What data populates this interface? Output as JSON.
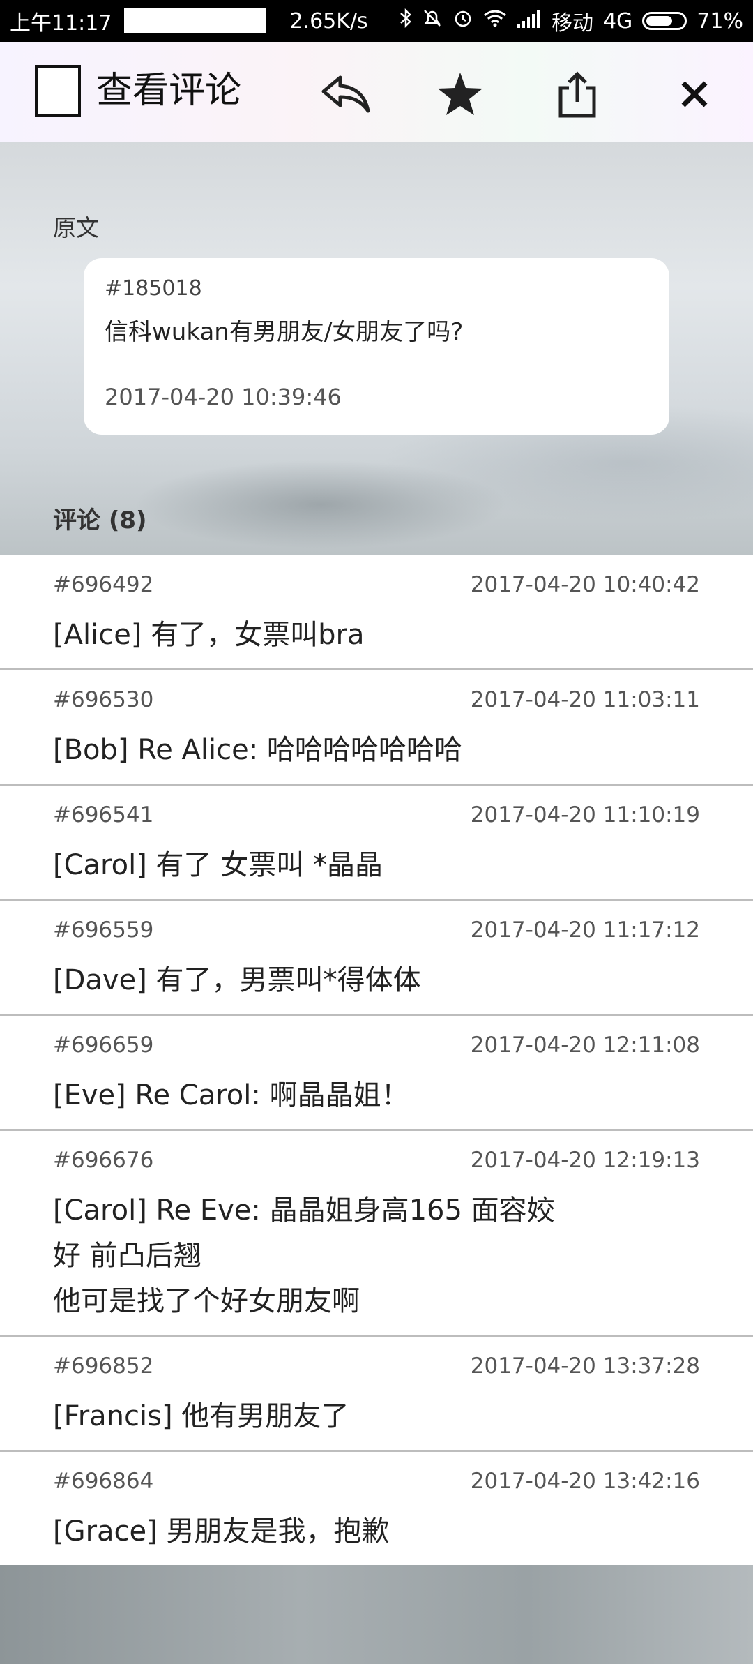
{
  "status_bar": {
    "time": "上午11:17",
    "network_speed": "2.65K/s",
    "carrier": "移动",
    "network_type": "4G",
    "battery_percent": "71%",
    "battery_level": 0.71,
    "icons": [
      "bluetooth-icon",
      "mute-icon",
      "alarm-icon",
      "wifi-icon",
      "signal-icon",
      "battery-icon"
    ]
  },
  "toolbar": {
    "title": "查看评论",
    "actions": [
      "reply-icon",
      "star-icon",
      "share-icon",
      "close-icon"
    ]
  },
  "original": {
    "section_label": "原文",
    "id": "#185018",
    "text": "信科wukan有男朋友/女朋友了吗?",
    "time": "2017-04-20 10:39:46"
  },
  "comments_section": {
    "label": "评论 (8)"
  },
  "comments": [
    {
      "id": "#696492",
      "time": "2017-04-20 10:40:42",
      "lines": [
        "[Alice] 有了，女票叫bra"
      ]
    },
    {
      "id": "#696530",
      "time": "2017-04-20 11:03:11",
      "lines": [
        "[Bob] Re Alice: 哈哈哈哈哈哈哈"
      ]
    },
    {
      "id": "#696541",
      "time": "2017-04-20 11:10:19",
      "lines": [
        "[Carol] 有了 女票叫 *晶晶"
      ]
    },
    {
      "id": "#696559",
      "time": "2017-04-20 11:17:12",
      "lines": [
        "[Dave] 有了，男票叫*得体体"
      ]
    },
    {
      "id": "#696659",
      "time": "2017-04-20 12:11:08",
      "lines": [
        "[Eve] Re Carol: 啊晶晶姐！"
      ]
    },
    {
      "id": "#696676",
      "time": "2017-04-20 12:19:13",
      "lines": [
        "[Carol] Re Eve: 晶晶姐身高165 面容姣",
        "好 前凸后翘",
        "他可是找了个好女朋友啊"
      ]
    },
    {
      "id": "#696852",
      "time": "2017-04-20 13:37:28",
      "lines": [
        "[Francis] 他有男朋友了"
      ]
    },
    {
      "id": "#696864",
      "time": "2017-04-20 13:42:16",
      "lines": [
        "[Grace] 男朋友是我，抱歉"
      ]
    }
  ]
}
